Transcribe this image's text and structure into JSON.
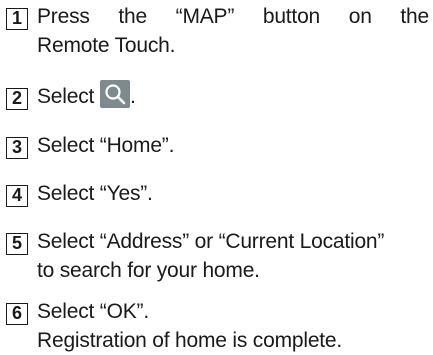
{
  "steps": [
    {
      "number": "1",
      "line1_words": [
        "Press",
        "the",
        "“MAP”",
        "button",
        "on",
        "the"
      ],
      "line2": "Remote Touch."
    },
    {
      "number": "2",
      "before_icon": "Select",
      "icon": "search-icon",
      "after_icon": "."
    },
    {
      "number": "3",
      "line1": "Select “Home”."
    },
    {
      "number": "4",
      "line1": "Select “Yes”."
    },
    {
      "number": "5",
      "line1": "Select “Address” or “Current Location”",
      "line2": "to search for your home."
    },
    {
      "number": "6",
      "line1": "Select “OK”.",
      "line2": "Registration of home is complete."
    }
  ],
  "colors": {
    "text": "#1a1a1a",
    "icon_background": "#7f8a8e",
    "icon_foreground": "#ffffff"
  }
}
